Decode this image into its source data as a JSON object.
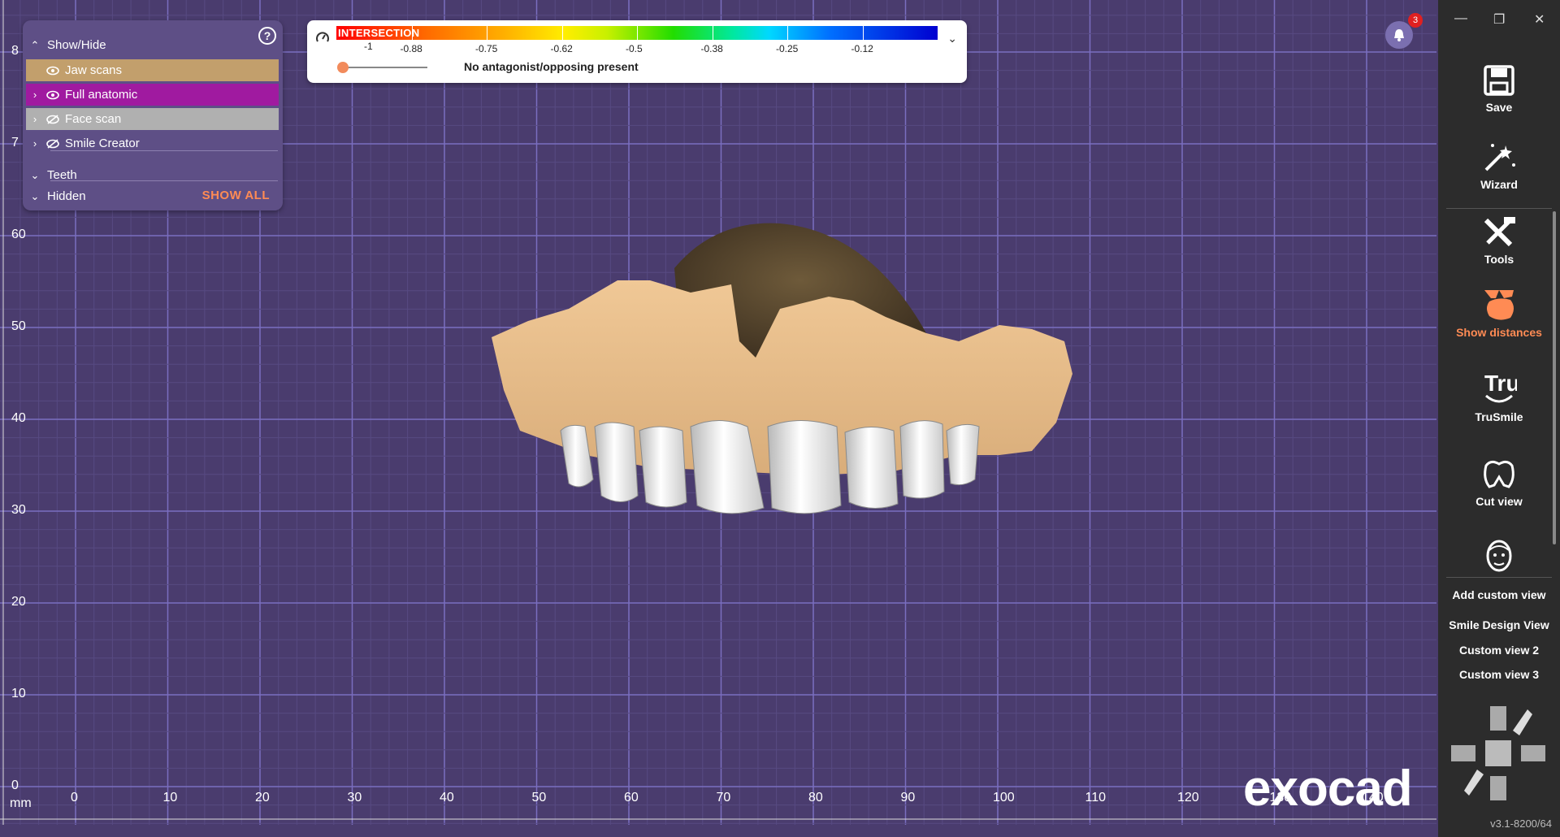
{
  "viewport": {
    "unit_label": "mm",
    "x_ticks": [
      "0",
      "10",
      "20",
      "30",
      "40",
      "50",
      "60",
      "70",
      "80",
      "90",
      "100",
      "110",
      "120",
      "130",
      "140"
    ],
    "y_ticks": [
      "0",
      "10",
      "20",
      "30",
      "40",
      "50",
      "60",
      "70",
      "80"
    ],
    "y_tick_labels_shown": [
      "0",
      "10",
      "20",
      "30",
      "40",
      "50",
      "60",
      "7",
      "8"
    ]
  },
  "showhide": {
    "title": "Show/Hide",
    "items": [
      {
        "label": "Jaw scans",
        "visible": true,
        "bg": "#c29f6c"
      },
      {
        "label": "Full anatomic",
        "visible": true,
        "bg": "#a01aa0"
      },
      {
        "label": "Face scan",
        "visible": false,
        "bg": "#b0b0b0"
      },
      {
        "label": "Smile Creator",
        "visible": false,
        "bg": "none"
      }
    ],
    "teeth_label": "Teeth",
    "hidden_label": "Hidden",
    "show_all_label": "SHOW ALL"
  },
  "colorbar": {
    "label": "INTERSECTION",
    "ticks": [
      "-1",
      "-0.88",
      "-0.75",
      "-0.62",
      "-0.5",
      "-0.38",
      "-0.25",
      "-0.12"
    ],
    "status": "No antagonist/opposing present"
  },
  "notifications": {
    "count": "3"
  },
  "logo": "exocad",
  "sidebar": {
    "tools": [
      {
        "label": "Save",
        "icon": "save-icon"
      },
      {
        "label": "Wizard",
        "icon": "wizard-icon"
      },
      {
        "label": "Tools",
        "icon": "tools-icon"
      },
      {
        "label": "Show distances",
        "icon": "show-distances-icon",
        "active": true
      },
      {
        "label": "TruSmile",
        "icon": "trusmile-icon"
      },
      {
        "label": "Cut view",
        "icon": "cut-view-icon"
      }
    ],
    "add_custom_view": "Add custom view",
    "views": [
      "Smile Design View",
      "Custom view 2",
      "Custom view 3"
    ],
    "version": "v3.1-8200/64",
    "accent": "#ff8b54"
  }
}
